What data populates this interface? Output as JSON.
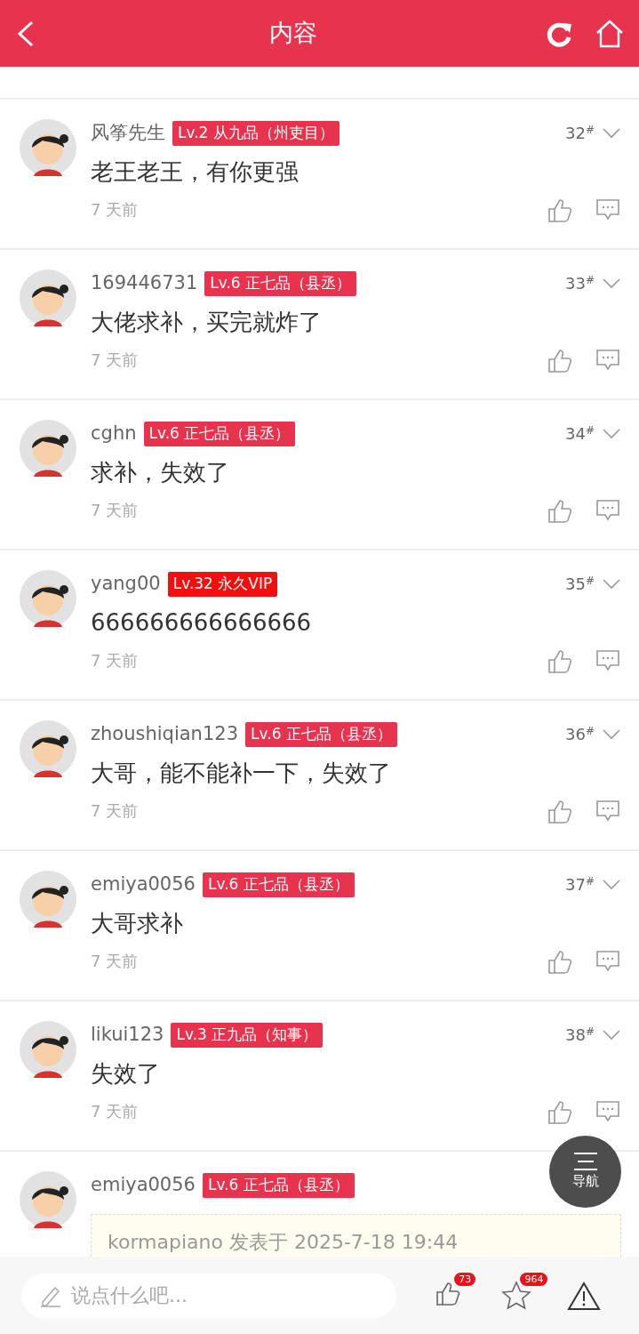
{
  "header": {
    "title": "内容"
  },
  "comments": [
    {
      "user": "风筝先生",
      "badge": {
        "text": "Lv.2 从九品（州吏目）",
        "color": "#e8334f"
      },
      "text": "老王老王，有你更强",
      "time": "7 天前",
      "floor": "32$^{#}$"
    },
    {
      "user": "169446731",
      "badge": {
        "text": "Lv.6 正七品（县丞）",
        "color": "#e8334f"
      },
      "text": "大佬求补，买完就炸了",
      "time": "7 天前",
      "floor": "33$^{#}$"
    },
    {
      "user": "cghn",
      "badge": {
        "text": "Lv.6 正七品（县丞）",
        "color": "#e8334f"
      },
      "text": "求补，失效了",
      "time": "7 天前",
      "floor": "34$^{#}$"
    },
    {
      "user": "yang00",
      "badge": {
        "text": "Lv.32 永久VIP",
        "color": "#f01010"
      },
      "text": "666666666666666",
      "time": "7 天前",
      "floor": "35$^{#}$"
    },
    {
      "user": "zhoushiqian123",
      "badge": {
        "text": "Lv.6 正七品（县丞）",
        "color": "#e8334f"
      },
      "text": "大哥，能不能补一下，失效了",
      "time": "7 天前",
      "floor": "36$^{#}$"
    },
    {
      "user": "emiya0056",
      "badge": {
        "text": "Lv.6 正七品（县丞）",
        "color": "#e8334f"
      },
      "text": "大哥求补",
      "time": "7 天前",
      "floor": "37$^{#}$"
    },
    {
      "user": "likui123",
      "badge": {
        "text": "Lv.3 正九品（知事）",
        "color": "#e8334f"
      },
      "text": "失效了",
      "time": "7 天前",
      "floor": "38$^{#}$"
    },
    {
      "user": "emiya0056",
      "badge": {
        "text": "Lv.6 正七品（县丞）",
        "color": "#e8334f"
      },
      "quote": "kormapiano 发表于 2025-7-18 19:44"
    }
  ],
  "nav_button": {
    "label": "导航"
  },
  "bottom_bar": {
    "placeholder": "说点什么吧...",
    "likes": "73",
    "favorites": "964"
  }
}
